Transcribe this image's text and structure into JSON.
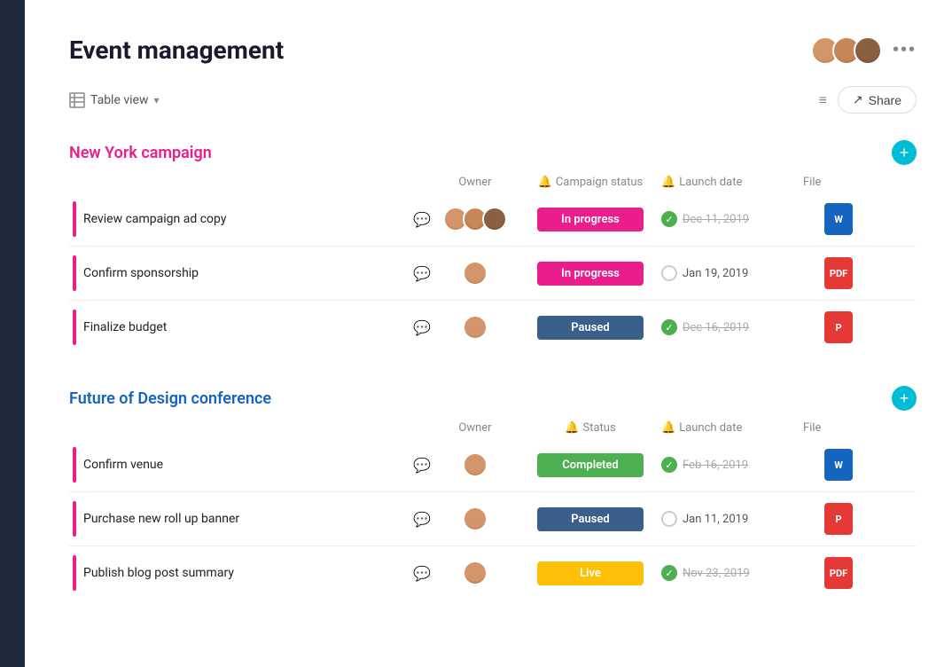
{
  "page": {
    "title": "Event management",
    "more_label": "•••"
  },
  "toolbar": {
    "view_label": "Table view",
    "share_label": "Share"
  },
  "sections": [
    {
      "id": "ny-campaign",
      "title": "New York campaign",
      "title_color": "pink",
      "col_headers": {
        "owner": "Owner",
        "status": "Campaign status",
        "date": "Launch date",
        "file": "File"
      },
      "tasks": [
        {
          "name": "Review campaign ad copy",
          "owners": 3,
          "status": "In progress",
          "status_type": "inprogress",
          "date_completed": true,
          "date": "Dec 11, 2019",
          "file_type": "word"
        },
        {
          "name": "Confirm sponsorship",
          "owners": 1,
          "status": "In progress",
          "status_type": "inprogress",
          "date_completed": false,
          "date": "Jan 19, 2019",
          "file_type": "pdf"
        },
        {
          "name": "Finalize budget",
          "owners": 1,
          "status": "Paused",
          "status_type": "paused",
          "date_completed": true,
          "date": "Dec 16, 2019",
          "file_type": "ppt"
        }
      ]
    },
    {
      "id": "fod-conference",
      "title": "Future of Design conference",
      "title_color": "blue",
      "col_headers": {
        "owner": "Owner",
        "status": "Status",
        "date": "Launch date",
        "file": "File"
      },
      "tasks": [
        {
          "name": "Confirm venue",
          "owners": 1,
          "status": "Completed",
          "status_type": "completed",
          "date_completed": true,
          "date": "Feb 16, 2019",
          "file_type": "word"
        },
        {
          "name": "Purchase new roll up banner",
          "owners": 1,
          "status": "Paused",
          "status_type": "paused",
          "date_completed": false,
          "date": "Jan 11, 2019",
          "file_type": "ppt"
        },
        {
          "name": "Publish blog post summary",
          "owners": 1,
          "status": "Live",
          "status_type": "live",
          "date_completed": true,
          "date": "Nov 23, 2019",
          "file_type": "pdf"
        }
      ]
    }
  ]
}
